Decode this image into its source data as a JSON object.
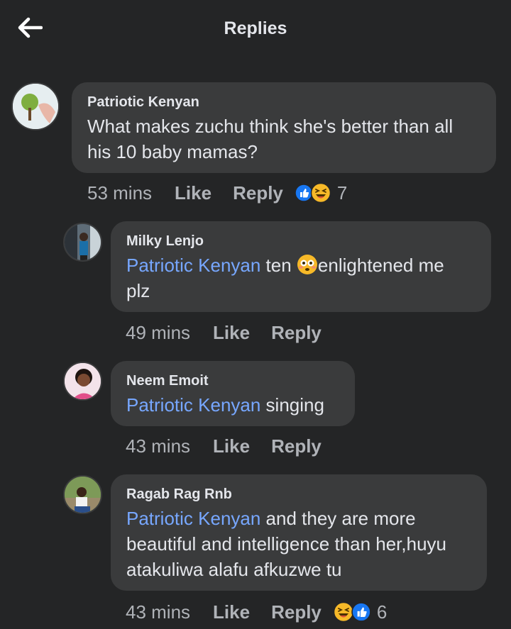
{
  "header": {
    "title": "Replies"
  },
  "comments": [
    {
      "author": "Patriotic Kenyan",
      "mention": "",
      "text": "What makes zuchu think she's better than all his 10 baby mamas?",
      "time": "53 mins",
      "like": "Like",
      "reply": "Reply",
      "reaction_count": "7",
      "reactions": [
        "like-icon",
        "laugh-emoji"
      ]
    },
    {
      "author": "Milky Lenjo",
      "mention": "Patriotic Kenyan",
      "text_a": " ten ",
      "text_b": "enlightened me",
      "text_c": "plz",
      "time": "49 mins",
      "like": "Like",
      "reply": "Reply"
    },
    {
      "author": "Neem Emoit",
      "mention": "Patriotic Kenyan",
      "text": " singing",
      "time": "43 mins",
      "like": "Like",
      "reply": "Reply"
    },
    {
      "author": "Ragab Rag Rnb",
      "mention": "Patriotic Kenyan",
      "text_a": " and they are more",
      "text_b": "beautiful and intelligence than her,huyu",
      "text_c": "atakuliwa alafu afkuzwe tu",
      "time": "43 mins",
      "like": "Like",
      "reply": "Reply",
      "reaction_count": "6",
      "reactions": [
        "laugh-emoji",
        "like-icon"
      ]
    }
  ],
  "colors": {
    "background": "#242526",
    "bubble": "#3a3b3c",
    "mention": "#77a7ff",
    "like_blue": "#1877f2",
    "emoji_yellow": "#f7b928"
  }
}
